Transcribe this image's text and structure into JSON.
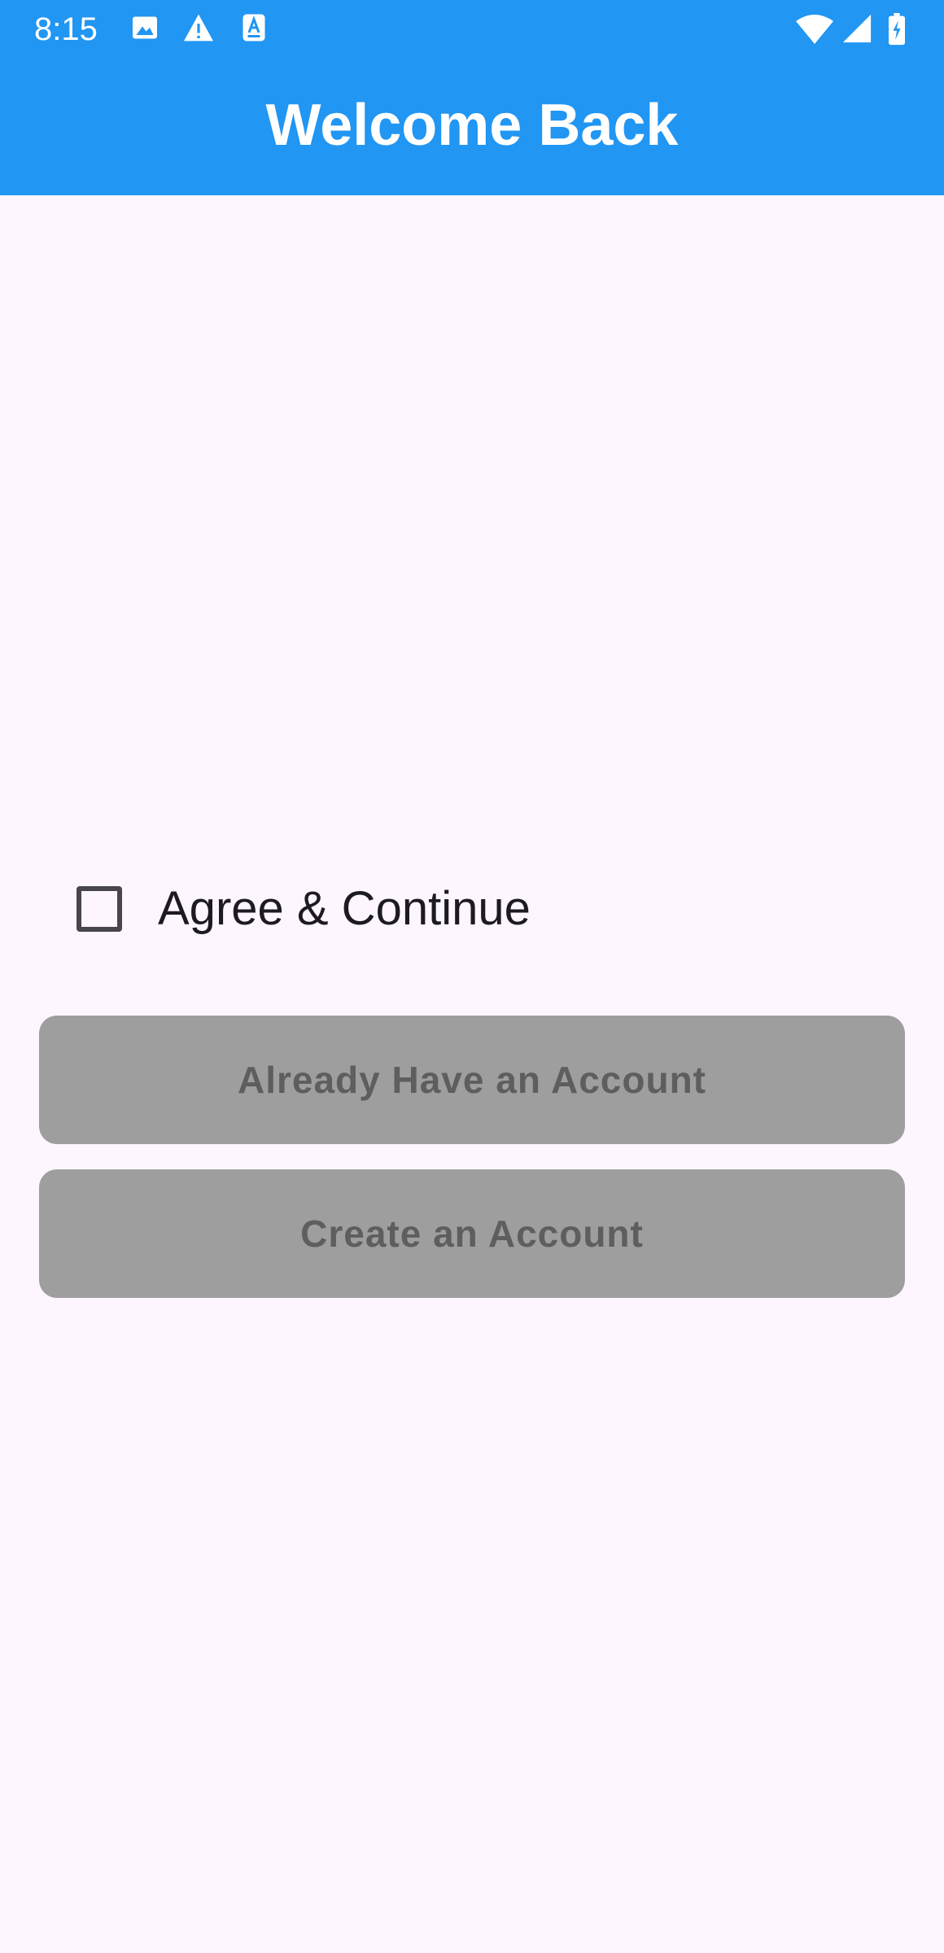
{
  "status_bar": {
    "time": "8:15",
    "left_icons": [
      "image-icon",
      "warning-icon",
      "text-a-icon"
    ],
    "right_icons": [
      "wifi-icon",
      "cellular-signal-icon",
      "battery-charging-icon"
    ]
  },
  "app_bar": {
    "title": "Welcome Back",
    "background_color": "#2196F3",
    "title_color": "#FFFFFF"
  },
  "agreement": {
    "checkbox_checked": false,
    "label": "Agree & Continue"
  },
  "actions": {
    "login_label": "Already Have an Account",
    "create_label": "Create an Account",
    "enabled": false,
    "button_color": "#9E9E9E",
    "button_text_color": "#5E5E5E"
  },
  "background_color": "#FDF6FE"
}
